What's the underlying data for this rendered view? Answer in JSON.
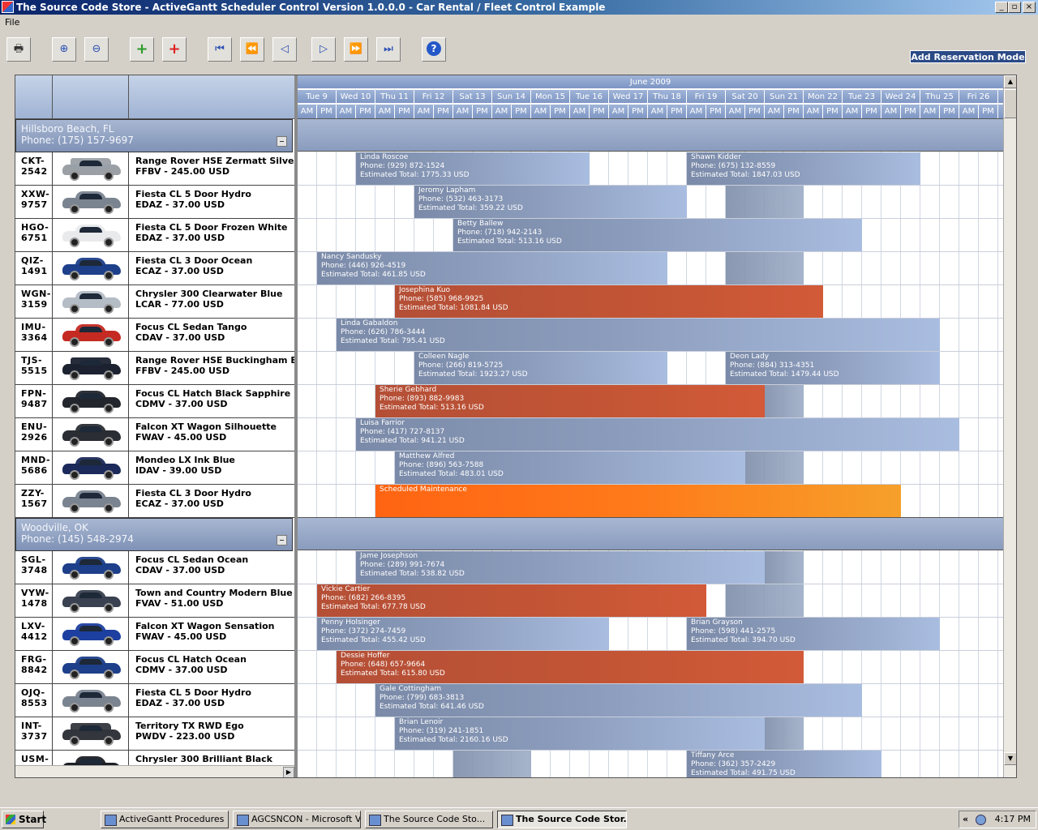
{
  "window": {
    "title": "The Source Code Store - ActiveGantt Scheduler Control Version 1.0.0.0 - Car Rental / Fleet Control Example"
  },
  "menu": {
    "file": "File"
  },
  "toolbar": {
    "mode_label": "Add Reservation Mode",
    "help_label": "?"
  },
  "timeline": {
    "month": "June 2009",
    "days": [
      "Tue 9",
      "Wed 10",
      "Thu 11",
      "Fri 12",
      "Sat 13",
      "Sun 14",
      "Mon 15",
      "Tue 16",
      "Wed 17",
      "Thu 18",
      "Fri 19",
      "Sat 20",
      "Sun 21",
      "Mon 22",
      "Tue 23",
      "Wed 24",
      "Thu 25",
      "Fri 26"
    ],
    "am": "AM",
    "pm": "PM"
  },
  "groups": [
    {
      "name": "Hillsboro Beach, FL",
      "phone": "Phone: (175) 157-9697",
      "rows": [
        {
          "code": "CKT-\n2542",
          "model": "Range Rover HSE Zermatt Silver",
          "rate": "FFBV - 245.00 USD",
          "color": "#9aa0a6",
          "suv": true,
          "bars": [
            {
              "type": "blue",
              "start": 3,
              "len": 12,
              "name": "Linda Roscoe",
              "phone": "Phone: (929) 872-1524",
              "total": "Estimated Total: 1775.33 USD"
            },
            {
              "type": "blue",
              "start": 20,
              "len": 12,
              "name": "Shawn Kidder",
              "phone": "Phone: (675) 132-8559",
              "total": "Estimated Total: 1847.03 USD"
            }
          ]
        },
        {
          "code": "XXW-\n9757",
          "model": "Fiesta CL 5 Door Hydro",
          "rate": "EDAZ - 37.00 USD",
          "color": "#7a8490",
          "bars": [
            {
              "type": "blue",
              "start": 6,
              "len": 14,
              "name": "Jeromy Lapham",
              "phone": "Phone: (532) 463-3173",
              "total": "Estimated Total: 359.22 USD"
            }
          ],
          "shade": {
            "start": 22,
            "len": 4
          }
        },
        {
          "code": "HGO-\n6751",
          "model": "Fiesta CL 5 Door Frozen White",
          "rate": "EDAZ - 37.00 USD",
          "color": "#e8eaec",
          "bars": [
            {
              "type": "blue",
              "start": 8,
              "len": 21,
              "name": "Betty Ballew",
              "phone": "Phone: (718) 942-2143",
              "total": "Estimated Total: 513.16 USD"
            }
          ]
        },
        {
          "code": "QIZ-\n1491",
          "model": "Fiesta CL 3 Door Ocean",
          "rate": "ECAZ - 37.00 USD",
          "color": "#1e3f8a",
          "bars": [
            {
              "type": "blue",
              "start": 1,
              "len": 18,
              "name": "Nancy Sandusky",
              "phone": "Phone: (446) 926-4519",
              "total": "Estimated Total: 461.85 USD"
            }
          ],
          "shade": {
            "start": 22,
            "len": 4
          }
        },
        {
          "code": "WGN-\n3159",
          "model": "Chrysler 300 Clearwater Blue",
          "rate": "LCAR - 77.00 USD",
          "color": "#b4bcc6",
          "bars": [
            {
              "type": "red",
              "start": 5,
              "len": 22,
              "name": "Josephina Kuo",
              "phone": "Phone: (585) 968-9925",
              "total": "Estimated Total: 1081.84 USD"
            }
          ]
        },
        {
          "code": "IMU-\n3364",
          "model": "Focus CL Sedan Tango",
          "rate": "CDAV - 37.00 USD",
          "color": "#c42a22",
          "bars": [
            {
              "type": "blue",
              "start": 2,
              "len": 31,
              "name": "Linda Gabaldon",
              "phone": "Phone: (626) 786-3444",
              "total": "Estimated Total: 795.41 USD"
            }
          ]
        },
        {
          "code": "TJS-\n5515",
          "model": "Range Rover HSE Buckingham Blue",
          "rate": "FFBV - 245.00 USD",
          "color": "#1c2230",
          "suv": true,
          "bars": [
            {
              "type": "blue",
              "start": 6,
              "len": 13,
              "name": "Colleen Nagle",
              "phone": "Phone: (266) 819-5725",
              "total": "Estimated Total: 1923.27 USD"
            },
            {
              "type": "blue",
              "start": 22,
              "len": 11,
              "name": "Deon Lady",
              "phone": "Phone: (884) 313-4351",
              "total": "Estimated Total: 1479.44 USD"
            }
          ]
        },
        {
          "code": "FPN-\n9487",
          "model": "Focus CL Hatch Black Sapphire",
          "rate": "CDMV - 37.00 USD",
          "color": "#23262c",
          "bars": [
            {
              "type": "red",
              "start": 4,
              "len": 20,
              "name": "Sherie Gebhard",
              "phone": "Phone: (893) 882-9983",
              "total": "Estimated Total: 513.16 USD"
            }
          ],
          "shade": {
            "start": 24,
            "len": 2
          }
        },
        {
          "code": "ENU-\n2926",
          "model": "Falcon XT Wagon Silhouette",
          "rate": "FWAV - 45.00 USD",
          "color": "#2a2d33",
          "bars": [
            {
              "type": "blue",
              "start": 3,
              "len": 31,
              "name": "Luisa Farrior",
              "phone": "Phone: (417) 727-8137",
              "total": "Estimated Total: 941.21 USD"
            }
          ]
        },
        {
          "code": "MND-\n5686",
          "model": "Mondeo LX Ink Blue",
          "rate": "IDAV - 39.00 USD",
          "color": "#1b2a5a",
          "bars": [
            {
              "type": "blue",
              "start": 5,
              "len": 18,
              "name": "Matthew Alfred",
              "phone": "Phone: (896) 563-7588",
              "total": "Estimated Total: 483.01 USD"
            }
          ],
          "shade": {
            "start": 23,
            "len": 3
          }
        },
        {
          "code": "ZZY-\n1567",
          "model": "Fiesta CL 3 Door Hydro",
          "rate": "ECAZ - 37.00 USD",
          "color": "#7a8490",
          "bars": [
            {
              "type": "maint",
              "start": 4,
              "len": 27,
              "name": "Scheduled Maintenance",
              "phone": "",
              "total": ""
            }
          ]
        }
      ]
    },
    {
      "name": "Woodville, OK",
      "phone": "Phone: (145) 548-2974",
      "rows": [
        {
          "code": "SGL-\n3748",
          "model": "Focus CL Sedan Ocean",
          "rate": "CDAV - 37.00 USD",
          "color": "#1e3f8a",
          "bars": [
            {
              "type": "blue",
              "start": 3,
              "len": 21,
              "name": "Jame Josephson",
              "phone": "Phone: (289) 991-7674",
              "total": "Estimated Total: 538.82 USD"
            }
          ],
          "shade": {
            "start": 24,
            "len": 2
          }
        },
        {
          "code": "VYW-\n1478",
          "model": "Town and Country Modern Blue",
          "rate": "FVAV - 51.00 USD",
          "color": "#3a4150",
          "bars": [
            {
              "type": "red",
              "start": 1,
              "len": 20,
              "name": "Vickie Cartier",
              "phone": "Phone: (682) 266-8395",
              "total": "Estimated Total: 677.78 USD"
            }
          ],
          "shade": {
            "start": 22,
            "len": 4
          }
        },
        {
          "code": "LXV-\n4412",
          "model": "Falcon XT Wagon Sensation",
          "rate": "FWAV - 45.00 USD",
          "color": "#1c3fa0",
          "bars": [
            {
              "type": "blue",
              "start": 1,
              "len": 15,
              "name": "Penny Holsinger",
              "phone": "Phone: (372) 274-7459",
              "total": "Estimated Total: 455.42 USD"
            },
            {
              "type": "blue",
              "start": 20,
              "len": 13,
              "name": "Brian Grayson",
              "phone": "Phone: (598) 441-2575",
              "total": "Estimated Total: 394.70 USD"
            }
          ]
        },
        {
          "code": "FRG-\n8842",
          "model": "Focus CL Hatch Ocean",
          "rate": "CDMV - 37.00 USD",
          "color": "#1e3f8a",
          "bars": [
            {
              "type": "red",
              "start": 2,
              "len": 24,
              "name": "Dessie Hoffer",
              "phone": "Phone: (648) 657-9664",
              "total": "Estimated Total: 615.80 USD"
            }
          ]
        },
        {
          "code": "OJQ-\n8553",
          "model": "Fiesta CL 5 Door Hydro",
          "rate": "EDAZ - 37.00 USD",
          "color": "#7a8490",
          "bars": [
            {
              "type": "blue",
              "start": 4,
              "len": 25,
              "name": "Gale Cottingham",
              "phone": "Phone: (799) 683-3813",
              "total": "Estimated Total: 641.46 USD"
            }
          ]
        },
        {
          "code": "INT-\n3737",
          "model": "Territory TX RWD Ego",
          "rate": "PWDV - 223.00 USD",
          "color": "#33363c",
          "suv": true,
          "bars": [
            {
              "type": "blue",
              "start": 5,
              "len": 19,
              "name": "Brian Lenoir",
              "phone": "Phone: (319) 241-1851",
              "total": "Estimated Total: 2160.16 USD"
            }
          ],
          "shade": {
            "start": 24,
            "len": 2
          }
        },
        {
          "code": "USM-\n",
          "model": "Chrysler 300 Brilliant Black",
          "rate": "",
          "color": "#1c1f24",
          "bars": [
            {
              "type": "blue",
              "start": 20,
              "len": 10,
              "name": "Tiffany Arce",
              "phone": "Phone: (362) 357-2429",
              "total": "Estimated Total: 491.75 USD"
            }
          ],
          "shade": {
            "start": 8,
            "len": 4
          }
        }
      ]
    }
  ],
  "taskbar": {
    "start": "Start",
    "tasks": [
      "ActiveGantt Procedures ...",
      "AGCSNCON - Microsoft V...",
      "The Source Code Sto...",
      "The Source Code Stor..."
    ],
    "clock": "4:17 PM"
  }
}
